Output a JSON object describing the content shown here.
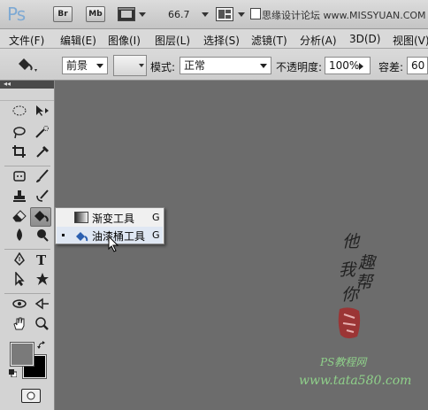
{
  "appbar": {
    "logo": "Ps",
    "br_label": "Br",
    "mb_label": "Mb",
    "zoom": "66.7",
    "watermark_url": "思缘设计论坛 www.MISSYUAN.COM"
  },
  "menubar": {
    "items": [
      "文件(F)",
      "编辑(E)",
      "图像(I)",
      "图层(L)",
      "选择(S)",
      "滤镜(T)",
      "分析(A)",
      "3D(D)",
      "视图(V)"
    ]
  },
  "options": {
    "fill_source": "前景",
    "mode_label": "模式:",
    "mode_value": "正常",
    "opacity_label": "不透明度:",
    "opacity_value": "100%",
    "tolerance_label": "容差:",
    "tolerance_value": "60"
  },
  "toolbox": {
    "collapse_label": "◂◂",
    "foreground_color": "#7a7a7a",
    "background_color": "#000000"
  },
  "flyout": {
    "items": [
      {
        "label": "渐变工具",
        "shortcut": "G",
        "icon": "gradient-icon",
        "selected": false
      },
      {
        "label": "油漆桶工具",
        "shortcut": "G",
        "icon": "paint-bucket-icon",
        "selected": true
      }
    ]
  },
  "canvas": {
    "calligraphy": [
      "他",
      "趣",
      "我",
      "帮",
      "你"
    ],
    "watermark_text": "PS教程网",
    "watermark_url": "www.tata580.com",
    "background_color": "#6c6c6c"
  }
}
